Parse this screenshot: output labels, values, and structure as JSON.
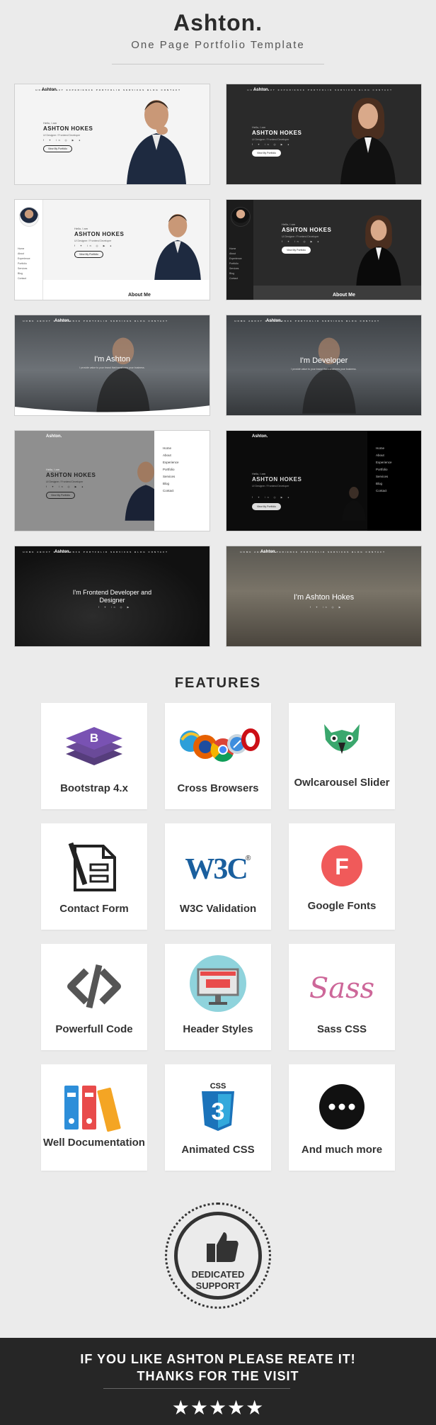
{
  "header": {
    "title": "Ashton.",
    "subtitle": "One Page Portfolio Template"
  },
  "previews": {
    "logo": "Ashton.",
    "nav_links": "HOME ABOUT EXPERIENCE PORTFOLIO SERVICES BLOG CONTACT",
    "hello": "Hello, I am",
    "name": "ASHTON HOKES",
    "role": "UI Designer / Frontend Developer",
    "button": "View My Portfolio",
    "about": "About Me",
    "sidebar_menu": [
      "Home",
      "About",
      "Experience",
      "Portfolio",
      "Services",
      "Blog",
      "Contact"
    ],
    "center_sub": "I provide value to your brand that transforms your business.",
    "headline_1": "I'm Ashton",
    "headline_2": "I'm Developer",
    "headline_3": "I'm Frontend Developer and Designer",
    "headline_4": "I'm Ashton Hokes"
  },
  "features": {
    "title": "FEATURES",
    "items": [
      {
        "label": "Bootstrap 4.x",
        "icon": "bootstrap-icon"
      },
      {
        "label": "Cross Browsers",
        "icon": "browsers-icon"
      },
      {
        "label": "Owlcarousel Slider",
        "icon": "owl-icon"
      },
      {
        "label": "Contact Form",
        "icon": "contact-form-icon"
      },
      {
        "label": "W3C Validation",
        "icon": "w3c-icon"
      },
      {
        "label": "Google Fonts",
        "icon": "google-fonts-icon"
      },
      {
        "label": "Powerfull Code",
        "icon": "code-icon"
      },
      {
        "label": "Header Styles",
        "icon": "monitor-icon"
      },
      {
        "label": "Sass CSS",
        "icon": "sass-icon"
      },
      {
        "label": "Well Documentation",
        "icon": "binders-icon"
      },
      {
        "label": "Animated CSS",
        "icon": "css3-icon"
      },
      {
        "label": "And much more",
        "icon": "more-icon"
      }
    ]
  },
  "support": {
    "line1": "DEDICATED",
    "line2": "SUPPORT"
  },
  "footer": {
    "line1": "IF YOU LIKE ASHTON PLEASE REATE IT!",
    "line2": "THANKS FOR THE VISIT",
    "stars": "★★★★★"
  },
  "colors": {
    "background": "#ebebeb",
    "footer_bg": "#262626",
    "bootstrap": "#7952b3",
    "google_fonts": "#f05a5a",
    "sass": "#cd6799",
    "css3": "#1b73ba"
  }
}
